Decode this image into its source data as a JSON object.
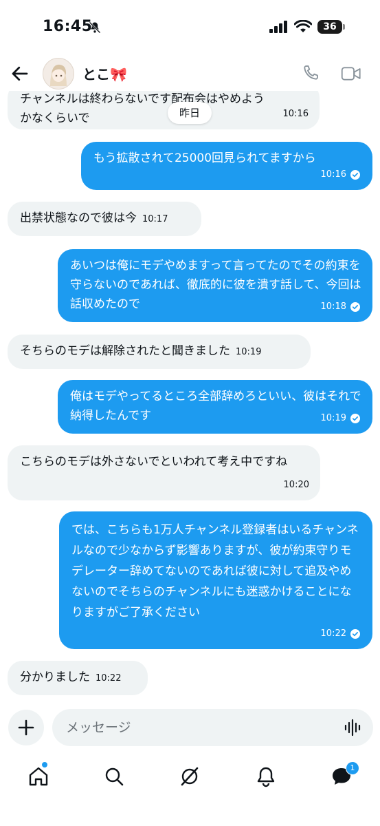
{
  "status": {
    "time": "16:45",
    "battery": "36"
  },
  "header": {
    "name": "とこ🎀"
  },
  "date_pill": "昨日",
  "messages": [
    {
      "dir": "in",
      "text": "チャンネルは終わらないです配布会はやめようかなくらいで",
      "time": "10:16"
    },
    {
      "dir": "out",
      "text": "もう拡散されて25000回見られてますから",
      "time": "10:16"
    },
    {
      "dir": "in",
      "text": "出禁状態なので彼は今",
      "time": "10:17"
    },
    {
      "dir": "out",
      "text": "あいつは俺にモデやめますって言ってたのでその約束を守らないのであれば、徹底的に彼を潰す話して、今回は話収めたので",
      "time": "10:18"
    },
    {
      "dir": "in",
      "text": "そちらのモデは解除されたと聞きました",
      "time": "10:19"
    },
    {
      "dir": "out",
      "text": "俺はモデやってるところ全部辞めろといい、彼はそれで納得したんです",
      "time": "10:19"
    },
    {
      "dir": "in",
      "text": "こちらのモデは外さないでといわれて考え中ですね",
      "time": "10:20"
    },
    {
      "dir": "out",
      "text": "では、こちらも1万人チャンネル登録者はいるチャンネルなので少なからず影響ありますが、彼が約束守りモデレーター辞めてないのであれば彼に対して追及やめないのでそちらのチャンネルにも迷惑かけることになりますがご了承ください",
      "time": "10:22"
    },
    {
      "dir": "in",
      "text": "分かりました",
      "time": "10:22"
    }
  ],
  "composer": {
    "placeholder": "メッセージ"
  },
  "tabbar": {
    "messages_badge": "1"
  },
  "colors": {
    "accent": "#1d9bf0",
    "incoming_bg": "#eff3f4",
    "text": "#0f1419"
  },
  "icons": [
    "bell-off-icon",
    "signal-icon",
    "wifi-icon",
    "back-arrow-icon",
    "phone-icon",
    "video-icon",
    "plus-icon",
    "voice-icon",
    "home-icon",
    "search-icon",
    "grok-icon",
    "notifications-icon",
    "messages-icon",
    "read-check-icon"
  ]
}
